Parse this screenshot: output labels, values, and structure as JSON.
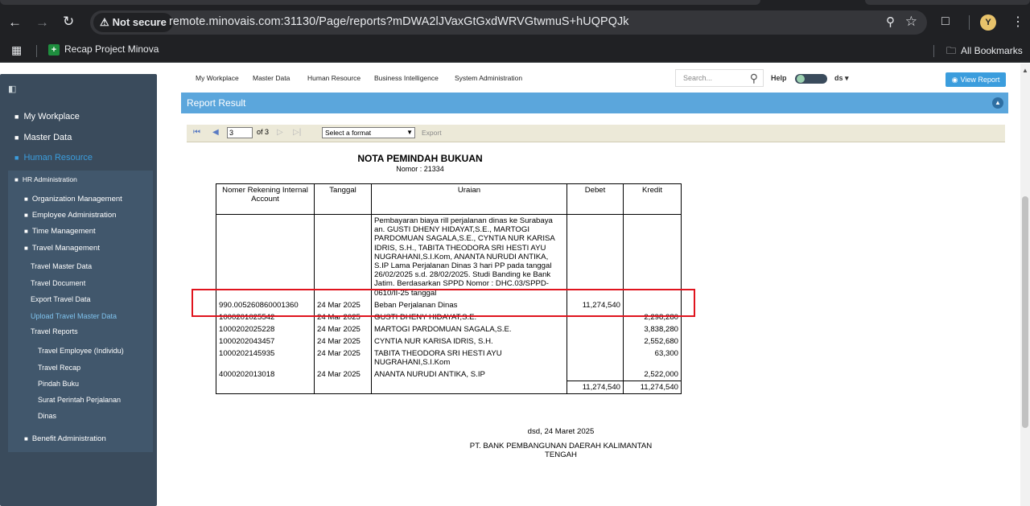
{
  "browser": {
    "security_label": "Not secure",
    "url": "remote.minovais.com:31130/Page/reports?mDWA2lJVaxGtGxdWRVGtwmuS+hUQPQJk",
    "bookmark_recap": "Recap Project Minova",
    "bookmark_all": "All Bookmarks",
    "profile_initial": "Y"
  },
  "topmenu": {
    "items": [
      "My Workplace",
      "Master Data",
      "Human Resource",
      "Business Intelligence",
      "System Administration"
    ],
    "search_placeholder": "Search...",
    "help": "Help",
    "user": "ds ▾",
    "view_report": "View Report"
  },
  "sidebar": {
    "my_workplace": "My Workplace",
    "master_data": "Master Data",
    "human_resource": "Human Resource",
    "hr_administration": "HR Administration",
    "organization_management": "Organization Management",
    "employee_administration": "Employee Administration",
    "time_management": "Time Management",
    "travel_management": "Travel Management",
    "travel_master_data": "Travel Master Data",
    "travel_document": "Travel Document",
    "export_travel_data": "Export Travel Data",
    "upload_travel_master_data": "Upload Travel Master Data",
    "travel_reports": "Travel Reports",
    "travel_employee": "Travel Employee (Individu)",
    "travel_recap": "Travel Recap",
    "pindah_buku": "Pindah Buku",
    "surat_perintah_1": "Surat Perintah Perjalanan",
    "surat_perintah_2": "Dinas",
    "benefit_administration": "Benefit Administration"
  },
  "panel": {
    "title": "Report Result"
  },
  "toolbar": {
    "current_page": "3",
    "of_pages": "of 3",
    "format_select": "Select a format",
    "export": "Export"
  },
  "report": {
    "title": "NOTA PEMINDAH BUKUAN",
    "number": "Nomor : 21334",
    "headers": {
      "account": "Nomer Rekening Internal Account",
      "date": "Tanggal",
      "desc": "Uraian",
      "debit": "Debet",
      "credit": "Kredit"
    },
    "narrative": "Pembayaran biaya rill perjalanan dinas ke Surabaya an. GUSTI DHENY HIDAYAT,S.E., MARTOGI PARDOMUAN SAGALA,S.E., CYNTIA NUR KARISA IDRIS, S.H., TABITA THEODORA SRI HESTI AYU NUGRAHANI,S.I.Kom, ANANTA NURUDI ANTIKA, S.IP Lama Perjalanan Dinas 3 hari PP pada tanggal 26/02/2025 s.d. 28/02/2025. Studi Banding ke Bank Jatim. Berdasarkan SPPD Nomor : DHC.03/SPPD-0610/II-25 tanggal",
    "rows": [
      {
        "account": "990.005260860001360",
        "date": "24 Mar 2025",
        "desc": "Beban Perjalanan Dinas",
        "debit": "11,274,540",
        "credit": ""
      },
      {
        "account": "1000201025542",
        "date": "24 Mar 2025",
        "desc": "GUSTI DHENY HIDAYAT,S.E.",
        "debit": "",
        "credit": "2,298,280"
      },
      {
        "account": "1000202025228",
        "date": "24 Mar 2025",
        "desc": "MARTOGI PARDOMUAN SAGALA,S.E.",
        "debit": "",
        "credit": "3,838,280"
      },
      {
        "account": "1000202043457",
        "date": "24 Mar 2025",
        "desc": "CYNTIA NUR KARISA IDRIS, S.H.",
        "debit": "",
        "credit": "2,552,680"
      },
      {
        "account": "1000202145935",
        "date": "24 Mar 2025",
        "desc": "TABITA THEODORA SRI HESTI AYU NUGRAHANI,S.I.Kom",
        "debit": "",
        "credit": "63,300"
      },
      {
        "account": "4000202013018",
        "date": "24 Mar 2025",
        "desc": "ANANTA NURUDI ANTIKA, S.IP",
        "debit": "",
        "credit": "2,522,000"
      }
    ],
    "total_debit": "11,274,540",
    "total_credit": "11,274,540",
    "signature_date": "dsd, 24 Maret 2025",
    "signature_bank": "PT. BANK PEMBANGUNAN DAERAH KALIMANTAN TENGAH"
  },
  "colors": {
    "sidebar_bg": "#3a4b5c",
    "accent_blue": "#3b9ddd",
    "panel_header": "#5ba6dc",
    "highlight_red": "#e0141e"
  }
}
